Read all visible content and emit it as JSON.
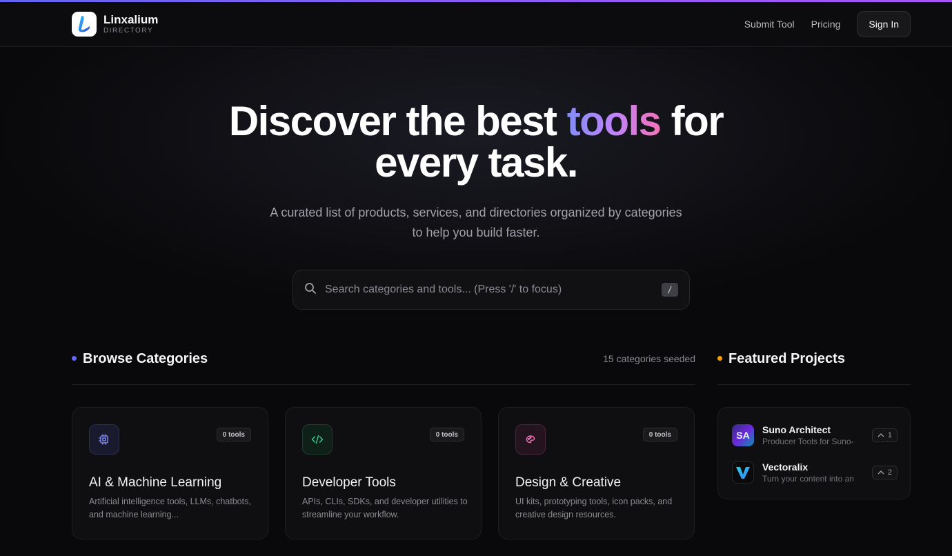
{
  "brand": {
    "name": "Linxalium",
    "subtitle": "DIRECTORY"
  },
  "nav": {
    "submit": "Submit Tool",
    "pricing": "Pricing",
    "signin": "Sign In"
  },
  "hero": {
    "title_pre": "Discover the best ",
    "title_highlight": "tools",
    "title_post_line1": " for",
    "title_line2": "every task.",
    "subtitle": "A curated list of products, services, and directories organized by categories to help you build faster."
  },
  "search": {
    "placeholder": "Search categories and tools... (Press '/' to focus)",
    "shortcut": "/"
  },
  "categories": {
    "title": "Browse Categories",
    "meta": "15 categories seeded",
    "items": [
      {
        "title": "AI & Machine Learning",
        "badge": "0 tools",
        "desc": "Artificial intelligence tools, LLMs, chatbots, and machine learning...",
        "icon": "cpu-icon"
      },
      {
        "title": "Developer Tools",
        "badge": "0 tools",
        "desc": "APIs, CLIs, SDKs, and developer utilities to streamline your workflow.",
        "icon": "code-icon"
      },
      {
        "title": "Design & Creative",
        "badge": "0 tools",
        "desc": "UI kits, prototyping tools, icon packs, and creative design resources.",
        "icon": "palette-icon"
      }
    ]
  },
  "featured": {
    "title": "Featured Projects",
    "items": [
      {
        "name": "Suno Architect",
        "desc": "Producer Tools for Suno-",
        "votes": "1",
        "logo_text": "SA"
      },
      {
        "name": "Vectoralix",
        "desc": "Turn your content into an",
        "votes": "2",
        "logo_text": "V"
      }
    ]
  },
  "colors": {
    "accent_blue": "#6366f1",
    "accent_orange": "#f59e0b"
  }
}
